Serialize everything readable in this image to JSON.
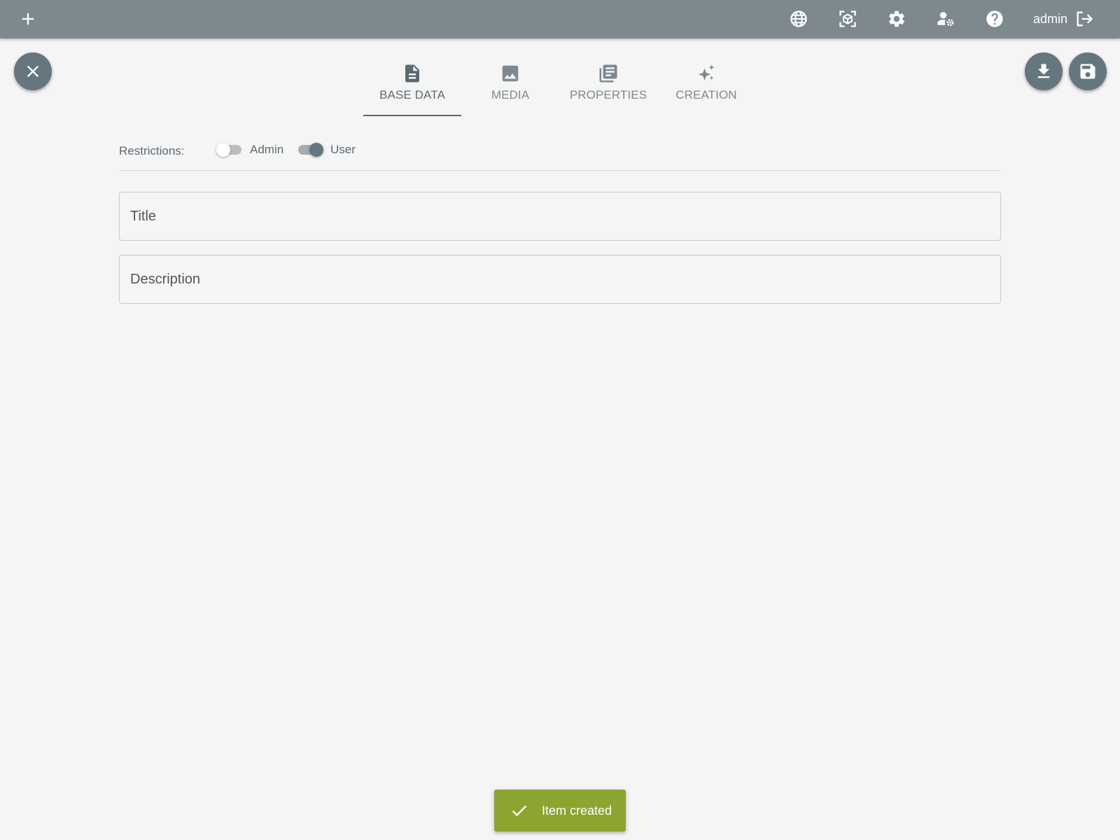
{
  "topbar": {
    "add_icon": "plus-icon",
    "language_icon": "globe-icon",
    "ar_icon": "cube-scan-icon",
    "settings_icon": "gear-icon",
    "user_settings_icon": "user-gear-icon",
    "help_icon": "help-circle-icon",
    "username": "admin",
    "logout_icon": "logout-icon"
  },
  "actions": {
    "close_icon": "close-icon",
    "download_icon": "download-icon",
    "save_icon": "save-icon"
  },
  "tabs": [
    {
      "label": "BASE DATA",
      "icon": "document-icon",
      "active": true
    },
    {
      "label": "MEDIA",
      "icon": "image-icon",
      "active": false
    },
    {
      "label": "PROPERTIES",
      "icon": "library-icon",
      "active": false
    },
    {
      "label": "CREATION",
      "icon": "sparkles-icon",
      "active": false
    }
  ],
  "restrictions": {
    "label": "Restrictions:",
    "toggles": [
      {
        "label": "Admin",
        "checked": false
      },
      {
        "label": "User",
        "checked": true
      }
    ]
  },
  "form": {
    "title_placeholder": "Title",
    "title_value": "",
    "description_placeholder": "Description",
    "description_value": ""
  },
  "snackbar": {
    "icon": "check-icon",
    "message": "Item created",
    "color": "#8ba530"
  },
  "colors": {
    "topbar": "#7d898f",
    "fab": "#66767e",
    "background": "#f5f5f5"
  }
}
